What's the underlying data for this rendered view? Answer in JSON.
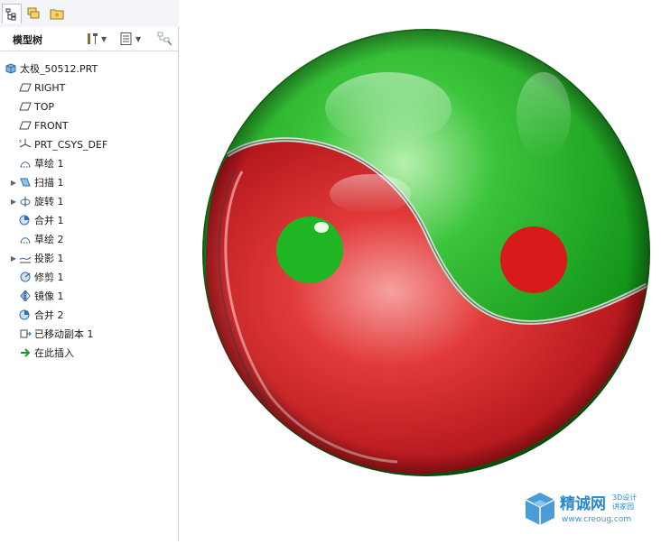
{
  "panel": {
    "title": "模型树"
  },
  "tree": {
    "root": "太极_50512.PRT",
    "items": [
      {
        "label": "RIGHT",
        "icon": "datum-plane-icon",
        "expandable": false
      },
      {
        "label": "TOP",
        "icon": "datum-plane-icon",
        "expandable": false
      },
      {
        "label": "FRONT",
        "icon": "datum-plane-icon",
        "expandable": false
      },
      {
        "label": "PRT_CSYS_DEF",
        "icon": "coordinate-system-icon",
        "expandable": false
      },
      {
        "label": "草绘 1",
        "icon": "sketch-icon",
        "expandable": false
      },
      {
        "label": "扫描 1",
        "icon": "sweep-icon",
        "expandable": true
      },
      {
        "label": "旋转 1",
        "icon": "revolve-icon",
        "expandable": true
      },
      {
        "label": "合并 1",
        "icon": "merge-icon",
        "expandable": false
      },
      {
        "label": "草绘 2",
        "icon": "sketch-icon",
        "expandable": false
      },
      {
        "label": "投影 1",
        "icon": "project-icon",
        "expandable": true
      },
      {
        "label": "修剪 1",
        "icon": "trim-icon",
        "expandable": false
      },
      {
        "label": "镜像 1",
        "icon": "mirror-icon",
        "expandable": false
      },
      {
        "label": "合并 2",
        "icon": "merge-icon",
        "expandable": false
      },
      {
        "label": "已移动副本 1",
        "icon": "moved-copy-icon",
        "expandable": false
      },
      {
        "label": "在此插入",
        "icon": "insert-here-arrow-icon",
        "expandable": false
      }
    ]
  },
  "model": {
    "name": "taiji-sphere",
    "colors": {
      "upper": "#1fae1f",
      "lower": "#d81c1c",
      "dot_on_red": "#21b021",
      "dot_on_green": "#d81a1a"
    }
  },
  "watermark": {
    "brand": "精诚网",
    "sub1": "3D设计",
    "sub2": "讲家园",
    "url": "www.creoug.com"
  }
}
